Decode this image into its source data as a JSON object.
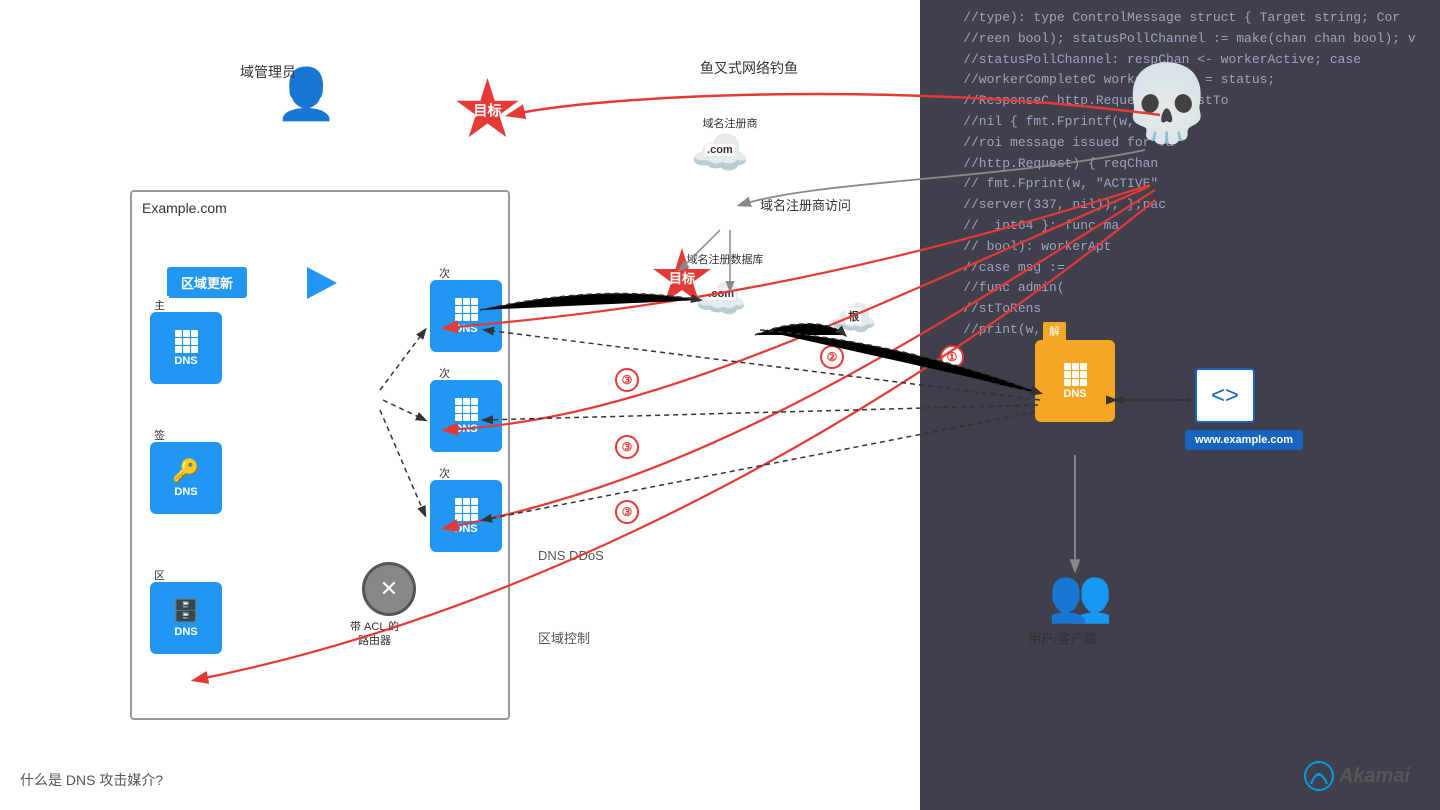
{
  "code_lines": [
    "//type): type ControlMessage struct { Target string; Cor",
    "//reen bool); statusPollChannel := make(chan chan bool); v",
    "//statusPollChannel: respChan <- workerActive; case",
    "//workerCompleteC workerActive = status;",
    "//ResponseC http.Request) { hostTo",
    "//nil { fmt.Fprintf(w,",
    "//roi message issued for Ta",
    "//http.Request) { reqChan",
    "// fmt.Fprint(w, \"ACTIVE\"",
    "//server(337, nil)); };pac",
    "//  int64 }: func ma",
    "// bool): workerApt",
    "//case msg :",
    "//func admin(",
    "//stToRens",
    "//print(w,",
    ""
  ],
  "labels": {
    "domain_admin": "域管理员",
    "target1": "目标",
    "target2": "目标",
    "spear_phishing": "鱼叉式网络钓鱼",
    "example_com": "Example.com",
    "zone_update": "区域更新",
    "primary_account": "主账户",
    "signer": "签名者",
    "zone_file": "区域文件",
    "secondary1": "次要",
    "secondary2": "次要",
    "secondary3": "次要",
    "dns": "DNS",
    "acl_router": "带 ACL 的\n路由器",
    "registrar": "域名注册商",
    "registrar_access": "域名注册商访问",
    "registrar_db": "域名注册数据库",
    "com_root": "根",
    "resolver": "解析器",
    "www_example": "www.example.com",
    "user_client": "用户/客户端",
    "dns_ddos": "DNS DDoS",
    "zone_control": "区域控制",
    "bottom_title": "什么是 DNS 攻击媒介?",
    "akamai": "Akamai",
    "dot_com": ".com",
    "dot_com2": ".com"
  }
}
